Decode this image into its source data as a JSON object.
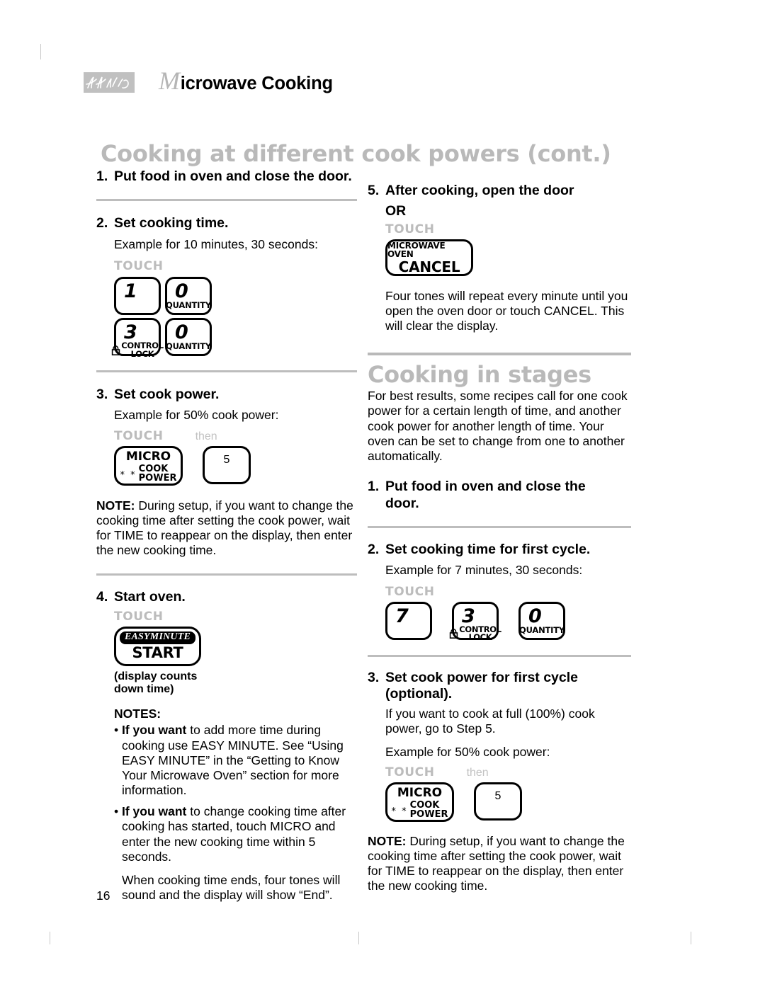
{
  "header": {
    "brand_logo": "kitchenaid-script-logo",
    "drop_cap": "M",
    "title": "icrowave Cooking"
  },
  "page_number": "16",
  "sections": {
    "cook_powers": {
      "heading": "Cooking at different cook powers (cont.)",
      "steps": [
        {
          "num": "1.",
          "title": "Put food in oven and close the door."
        },
        {
          "num": "2.",
          "title": "Set cooking time.",
          "example": "Example for 10 minutes, 30 seconds:",
          "touch_label": "TOUCH",
          "keys": [
            {
              "digit": "1",
              "sub": ""
            },
            {
              "digit": "0",
              "sub": "QUANTITY"
            },
            {
              "digit": "3",
              "sub": "CONTROL LOCK",
              "icon": "padlock-icon"
            },
            {
              "digit": "0",
              "sub": "QUANTITY"
            }
          ]
        },
        {
          "num": "3.",
          "title": "Set cook power.",
          "example": "Example for 50% cook power:",
          "touch_label": "TOUCH",
          "then_label": "then",
          "micro_key": {
            "top": "MICRO",
            "stars": "* *",
            "line1": "COOK",
            "line2": "POWER"
          },
          "power_digit": "5",
          "note_label": "NOTE:",
          "note_text": " During setup, if you want to change the cooking time after setting the cook power, wait for TIME to reappear on the display, then enter the new cooking time."
        },
        {
          "num": "4.",
          "title": "Start oven.",
          "touch_label": "TOUCH",
          "start_key": {
            "pill": "EASYMINUTE",
            "label": "START"
          },
          "caption": "(display counts down time)",
          "notes_title": "NOTES:",
          "notes": [
            {
              "bullet": "•",
              "lead": "If you want",
              "rest": " to add more time during cooking use EASY MINUTE. See “Using EASY MINUTE” in the “Getting to Know Your Microwave Oven” section for more information."
            },
            {
              "bullet": "•",
              "lead": "If you want",
              "rest": " to change cooking time after cooking has started, touch MICRO and enter the new cooking time within 5 seconds."
            }
          ],
          "closing_text": "When cooking time ends, four tones will sound and the display will show “End”."
        },
        {
          "num": "5.",
          "title": "After cooking, open the door",
          "or_label": "OR",
          "touch_label": "TOUCH",
          "cancel_key": {
            "top": "MICROWAVE OVEN",
            "label": "CANCEL"
          },
          "body": "Four tones will repeat every minute until you open the oven door or touch CANCEL. This will clear the display."
        }
      ]
    },
    "cooking_in_stages": {
      "heading": "Cooking in stages",
      "intro": "For best results, some recipes call for one cook power for a certain length of time, and another cook power for another length of time. Your oven can be set to change from one to another automatically.",
      "steps": [
        {
          "num": "1.",
          "title": "Put food in oven and close the door."
        },
        {
          "num": "2.",
          "title": "Set cooking time for first cycle.",
          "example": "Example for 7 minutes, 30 seconds:",
          "touch_label": "TOUCH",
          "keys": [
            {
              "digit": "7",
              "sub": ""
            },
            {
              "digit": "3",
              "sub": "CONTROL LOCK",
              "icon": "padlock-icon"
            },
            {
              "digit": "0",
              "sub": "QUANTITY"
            }
          ]
        },
        {
          "num": "3.",
          "title": "Set cook power for first cycle (optional).",
          "body": "If you want to cook at full (100%) cook power, go to Step 5.",
          "example": "Example for 50% cook power:",
          "touch_label": "TOUCH",
          "then_label": "then",
          "micro_key": {
            "top": "MICRO",
            "stars": "* *",
            "line1": "COOK",
            "line2": "POWER"
          },
          "power_digit": "5",
          "note_label": "NOTE:",
          "note_text": " During setup, if you want to change the cooking time after setting the cook power, wait for TIME to reappear on the display, then enter the new cooking time."
        }
      ]
    }
  },
  "colors": {
    "heading_gray": "#b9b9b9",
    "rule_gray": "#bdbdbd",
    "label_gray": "#bcbcbc",
    "text_black": "#000000"
  }
}
